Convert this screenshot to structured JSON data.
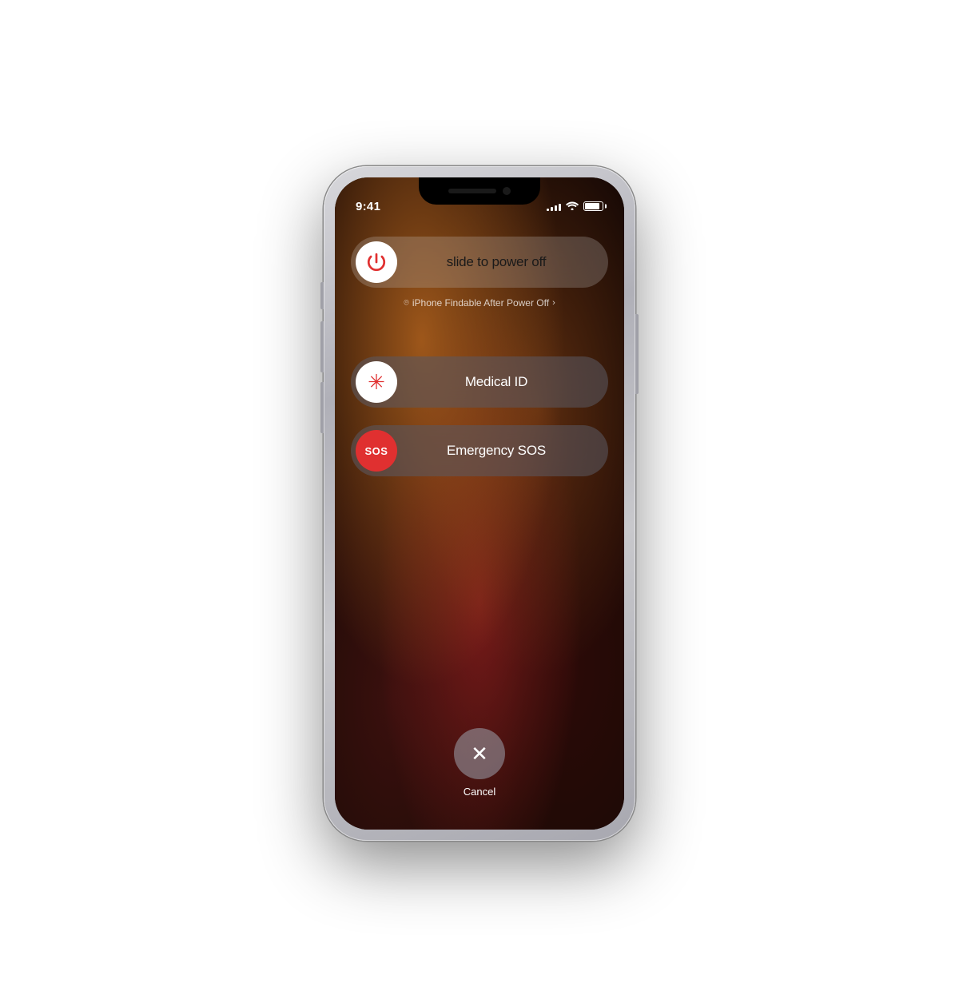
{
  "phone": {
    "status": {
      "time": "9:41",
      "signal_bars": [
        3,
        5,
        7,
        10,
        12
      ],
      "battery_level": 85
    },
    "power_slider": {
      "label": "slide to power off",
      "thumb_aria": "power-off-thumb"
    },
    "findable_text": "iPhone Findable After Power Off",
    "medical_id": {
      "icon_text": "*",
      "label": "Medical ID"
    },
    "emergency_sos": {
      "icon_text": "SOS",
      "label": "Emergency SOS"
    },
    "cancel": {
      "label": "Cancel"
    }
  }
}
